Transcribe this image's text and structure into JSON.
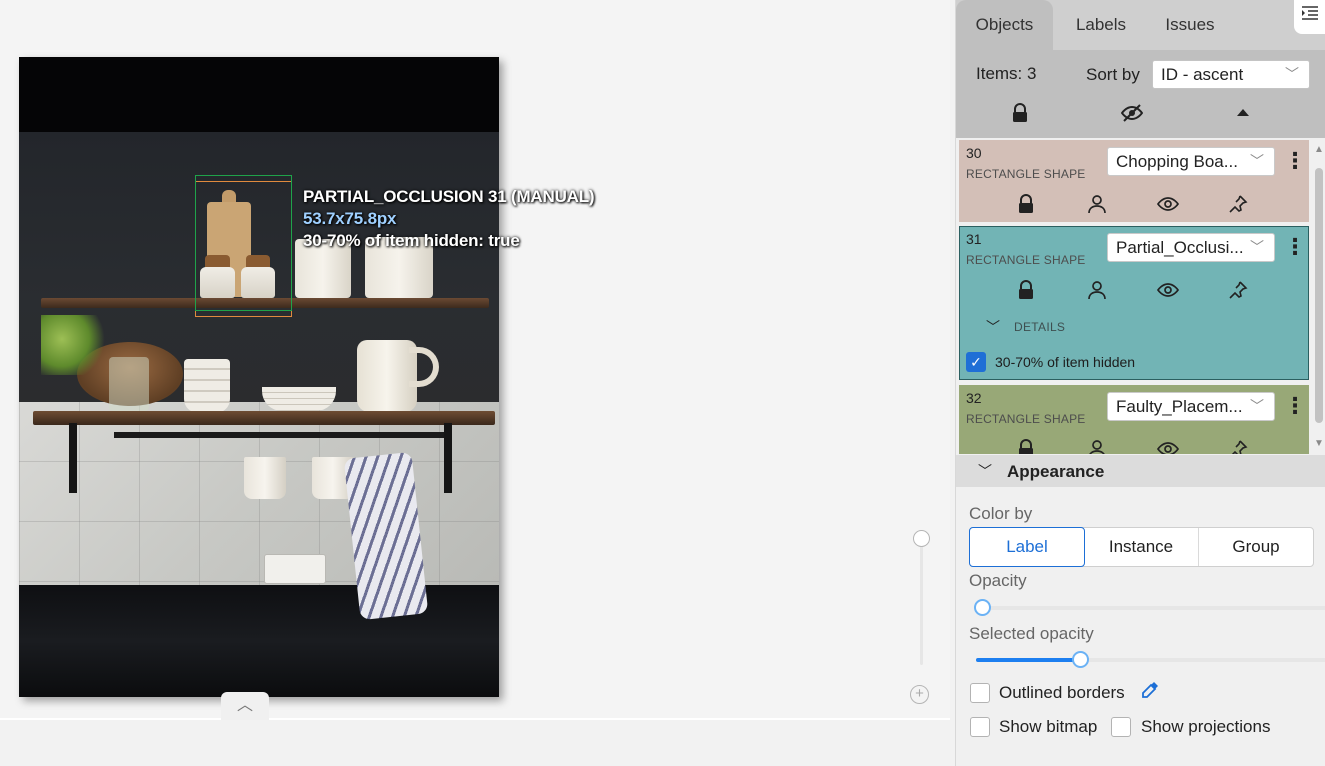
{
  "canvas": {
    "annotation": {
      "title": "PARTIAL_OCCLUSION 31 (MANUAL)",
      "size": "53.7x75.8px",
      "attribute": "30-70% of item hidden: true"
    },
    "colors": {
      "bbox_primary": "#1fa34a",
      "bbox_secondary": "#e08a3e",
      "size_text": "#9fd0ff"
    }
  },
  "sidebar": {
    "tabs": [
      {
        "label": "Objects",
        "active": true
      },
      {
        "label": "Labels",
        "active": false
      },
      {
        "label": "Issues",
        "active": false
      }
    ],
    "header": {
      "items_count": "Items: 3",
      "sort_label": "Sort by",
      "sort_value": "ID - ascent"
    },
    "objects": [
      {
        "id": "30",
        "type": "RECTANGLE SHAPE",
        "label": "Chopping Boa...",
        "color": "#d3bfb7"
      },
      {
        "id": "31",
        "type": "RECTANGLE SHAPE",
        "label": "Partial_Occlusi...",
        "color": "#72b4b5",
        "details_label": "DETAILS",
        "attribute_label": "30-70% of item hidden",
        "attribute_checked": true
      },
      {
        "id": "32",
        "type": "RECTANGLE SHAPE",
        "label": "Faulty_Placem...",
        "color": "#98a877"
      }
    ],
    "appearance": {
      "title": "Appearance",
      "color_by_label": "Color by",
      "color_by_options": [
        "Label",
        "Instance",
        "Group"
      ],
      "color_by_selected": "Label",
      "opacity_label": "Opacity",
      "opacity_value": 0.02,
      "selected_opacity_label": "Selected opacity",
      "selected_opacity_value": 0.3,
      "outlined_borders_label": "Outlined borders",
      "show_bitmap_label": "Show bitmap",
      "show_projections_label": "Show projections",
      "accent_color": "#1d6fd6"
    }
  }
}
